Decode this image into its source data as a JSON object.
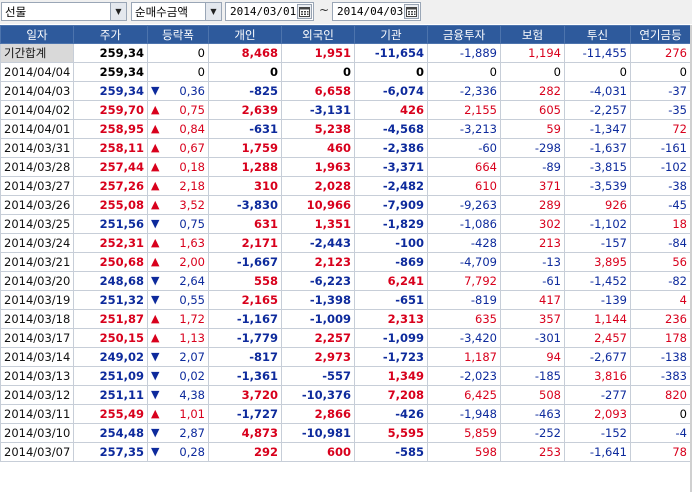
{
  "toolbar": {
    "market": "선물",
    "metric": "순매수금액",
    "date_from": "2014/03/01",
    "separator": "~",
    "date_to": "2014/04/03"
  },
  "columns": [
    "일자",
    "주가",
    "등락폭",
    "개인",
    "외국인",
    "기관",
    "금융투자",
    "보험",
    "투신",
    "연기금등"
  ],
  "total_row": {
    "label": "기간합계",
    "price": "259,34",
    "chg_dir": "",
    "chg": "0",
    "indiv": "8,468",
    "foreign": "1,951",
    "inst": "-11,654",
    "fin": "-1,889",
    "ins": "1,194",
    "trust": "-11,455",
    "pension": "276"
  },
  "rows": [
    {
      "date": "2014/04/04",
      "price": "259,34",
      "dir": "",
      "chg": "0",
      "indiv": "0",
      "foreign": "0",
      "inst": "0",
      "fin": "0",
      "ins": "0",
      "trust": "0",
      "pension": "0"
    },
    {
      "date": "2014/04/03",
      "price": "259,34",
      "dir": "down",
      "chg": "0,36",
      "indiv": "-825",
      "foreign": "6,658",
      "inst": "-6,074",
      "fin": "-2,336",
      "ins": "282",
      "trust": "-4,031",
      "pension": "-37"
    },
    {
      "date": "2014/04/02",
      "price": "259,70",
      "dir": "up",
      "chg": "0,75",
      "indiv": "2,639",
      "foreign": "-3,131",
      "inst": "426",
      "fin": "2,155",
      "ins": "605",
      "trust": "-2,257",
      "pension": "-35"
    },
    {
      "date": "2014/04/01",
      "price": "258,95",
      "dir": "up",
      "chg": "0,84",
      "indiv": "-631",
      "foreign": "5,238",
      "inst": "-4,568",
      "fin": "-3,213",
      "ins": "59",
      "trust": "-1,347",
      "pension": "72"
    },
    {
      "date": "2014/03/31",
      "price": "258,11",
      "dir": "up",
      "chg": "0,67",
      "indiv": "1,759",
      "foreign": "460",
      "inst": "-2,386",
      "fin": "-60",
      "ins": "-298",
      "trust": "-1,637",
      "pension": "-161"
    },
    {
      "date": "2014/03/28",
      "price": "257,44",
      "dir": "up",
      "chg": "0,18",
      "indiv": "1,288",
      "foreign": "1,963",
      "inst": "-3,371",
      "fin": "664",
      "ins": "-89",
      "trust": "-3,815",
      "pension": "-102"
    },
    {
      "date": "2014/03/27",
      "price": "257,26",
      "dir": "up",
      "chg": "2,18",
      "indiv": "310",
      "foreign": "2,028",
      "inst": "-2,482",
      "fin": "610",
      "ins": "371",
      "trust": "-3,539",
      "pension": "-38"
    },
    {
      "date": "2014/03/26",
      "price": "255,08",
      "dir": "up",
      "chg": "3,52",
      "indiv": "-3,830",
      "foreign": "10,966",
      "inst": "-7,909",
      "fin": "-9,263",
      "ins": "289",
      "trust": "926",
      "pension": "-45"
    },
    {
      "date": "2014/03/25",
      "price": "251,56",
      "dir": "down",
      "chg": "0,75",
      "indiv": "631",
      "foreign": "1,351",
      "inst": "-1,829",
      "fin": "-1,086",
      "ins": "302",
      "trust": "-1,102",
      "pension": "18"
    },
    {
      "date": "2014/03/24",
      "price": "252,31",
      "dir": "up",
      "chg": "1,63",
      "indiv": "2,171",
      "foreign": "-2,443",
      "inst": "-100",
      "fin": "-428",
      "ins": "213",
      "trust": "-157",
      "pension": "-84"
    },
    {
      "date": "2014/03/21",
      "price": "250,68",
      "dir": "up",
      "chg": "2,00",
      "indiv": "-1,667",
      "foreign": "2,123",
      "inst": "-869",
      "fin": "-4,709",
      "ins": "-13",
      "trust": "3,895",
      "pension": "56"
    },
    {
      "date": "2014/03/20",
      "price": "248,68",
      "dir": "down",
      "chg": "2,64",
      "indiv": "558",
      "foreign": "-6,223",
      "inst": "6,241",
      "fin": "7,792",
      "ins": "-61",
      "trust": "-1,452",
      "pension": "-82"
    },
    {
      "date": "2014/03/19",
      "price": "251,32",
      "dir": "down",
      "chg": "0,55",
      "indiv": "2,165",
      "foreign": "-1,398",
      "inst": "-651",
      "fin": "-819",
      "ins": "417",
      "trust": "-139",
      "pension": "4"
    },
    {
      "date": "2014/03/18",
      "price": "251,87",
      "dir": "up",
      "chg": "1,72",
      "indiv": "-1,167",
      "foreign": "-1,009",
      "inst": "2,313",
      "fin": "635",
      "ins": "357",
      "trust": "1,144",
      "pension": "236"
    },
    {
      "date": "2014/03/17",
      "price": "250,15",
      "dir": "up",
      "chg": "1,13",
      "indiv": "-1,779",
      "foreign": "2,257",
      "inst": "-1,099",
      "fin": "-3,420",
      "ins": "-301",
      "trust": "2,457",
      "pension": "178"
    },
    {
      "date": "2014/03/14",
      "price": "249,02",
      "dir": "down",
      "chg": "2,07",
      "indiv": "-817",
      "foreign": "2,973",
      "inst": "-1,723",
      "fin": "1,187",
      "ins": "94",
      "trust": "-2,677",
      "pension": "-138"
    },
    {
      "date": "2014/03/13",
      "price": "251,09",
      "dir": "down",
      "chg": "0,02",
      "indiv": "-1,361",
      "foreign": "-557",
      "inst": "1,349",
      "fin": "-2,023",
      "ins": "-185",
      "trust": "3,816",
      "pension": "-383"
    },
    {
      "date": "2014/03/12",
      "price": "251,11",
      "dir": "down",
      "chg": "4,38",
      "indiv": "3,720",
      "foreign": "-10,376",
      "inst": "7,208",
      "fin": "6,425",
      "ins": "508",
      "trust": "-277",
      "pension": "820"
    },
    {
      "date": "2014/03/11",
      "price": "255,49",
      "dir": "up",
      "chg": "1,01",
      "indiv": "-1,727",
      "foreign": "2,866",
      "inst": "-426",
      "fin": "-1,948",
      "ins": "-463",
      "trust": "2,093",
      "pension": "0"
    },
    {
      "date": "2014/03/10",
      "price": "254,48",
      "dir": "down",
      "chg": "2,87",
      "indiv": "4,873",
      "foreign": "-10,981",
      "inst": "5,595",
      "fin": "5,859",
      "ins": "-252",
      "trust": "-152",
      "pension": "-4"
    },
    {
      "date": "2014/03/07",
      "price": "257,35",
      "dir": "down",
      "chg": "0,28",
      "indiv": "292",
      "foreign": "600",
      "inst": "-585",
      "fin": "598",
      "ins": "253",
      "trust": "-1,641",
      "pension": "78"
    }
  ],
  "colors": {
    "header_bg": "#2e5a9c",
    "up": "#d8001c",
    "down": "#0d2a9c",
    "grid": "#c7ced8"
  },
  "icons": {
    "up_arrow": "triangle-up-icon",
    "down_arrow": "triangle-down-icon",
    "calendar": "calendar-icon",
    "dropdown": "chevron-down-icon"
  }
}
